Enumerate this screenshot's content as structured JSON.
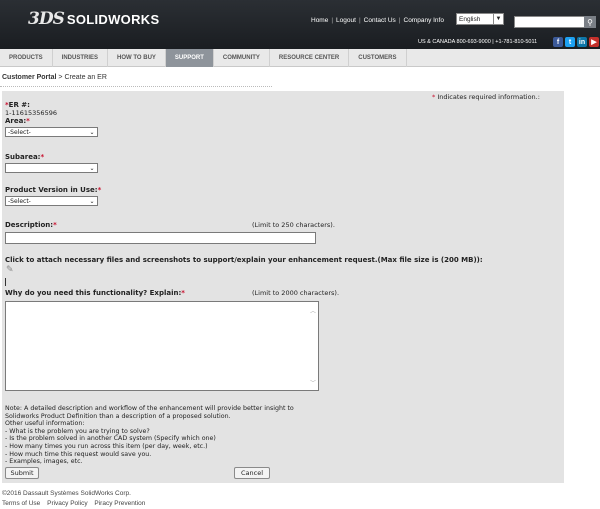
{
  "header": {
    "logo_mark": "3DS",
    "logo_text": "SOLIDWORKS",
    "links": [
      "Home",
      "Logout",
      "Contact Us",
      "Company Info"
    ],
    "language": "English",
    "phone": "US & CANADA 800-693-9000 | +1-781-810-5011",
    "social": [
      {
        "icon": "facebook-icon",
        "glyph": "f"
      },
      {
        "icon": "twitter-icon",
        "glyph": "t"
      },
      {
        "icon": "linkedin-icon",
        "glyph": "in"
      },
      {
        "icon": "youtube-icon",
        "glyph": "▶"
      }
    ]
  },
  "nav": {
    "items": [
      "PRODUCTS",
      "INDUSTRIES",
      "HOW TO BUY",
      "SUPPORT",
      "COMMUNITY",
      "RESOURCE CENTER",
      "CUSTOMERS"
    ],
    "active": "SUPPORT"
  },
  "breadcrumb": {
    "root": "Customer Portal",
    "separator": ">",
    "current": "Create an ER"
  },
  "form": {
    "required_note": "Indicates required information.:",
    "er_label": "ER #:",
    "er_value": "1-11615356596",
    "area_label": "Area:",
    "area_value": "-Select-",
    "subarea_label": "Subarea:",
    "subarea_value": "",
    "version_label": "Product Version in Use:",
    "version_value": "-Select-",
    "description_label": "Description:",
    "description_hint": "(Limit to 250 characters).",
    "attach_label": "Click to attach necessary files and screenshots to support/explain your enhancement request.(Max file size is (200 MB)):",
    "why_label": "Why do you need this functionality? Explain:",
    "why_hint": "(Limit to 2000 characters).",
    "note_lines": [
      "Note: A detailed description and workflow of the enhancement will provide better insight to",
      "Solidworks Product Definition than a description of a proposed solution.",
      "Other useful information:",
      "- What is the problem you are trying to solve?",
      "- Is the problem solved in another CAD system (Specify which one)",
      "- How many times you run across this item (per day, week, etc.)",
      "- How much time this request would save you.",
      "- Examples, images, etc."
    ],
    "submit_label": "Submit",
    "cancel_label": "Cancel"
  },
  "footer": {
    "copyright": "©2016 Dassault Systèmes SolidWorks Corp.",
    "links": [
      "Terms of Use",
      "Privacy Policy",
      "Piracy Prevention"
    ]
  }
}
